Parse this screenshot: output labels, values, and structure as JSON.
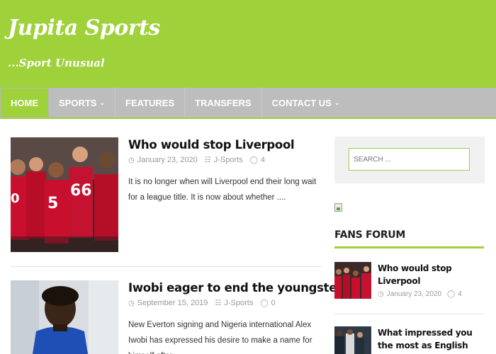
{
  "header": {
    "site_title": "Jupita Sports",
    "tagline": "...Sport Unusual",
    "bg_color": "#9ed13a"
  },
  "nav": {
    "items": [
      {
        "label": "HOME",
        "active": true,
        "dropdown": false
      },
      {
        "label": "SPORTS",
        "active": false,
        "dropdown": true
      },
      {
        "label": "FEATURES",
        "active": false,
        "dropdown": false
      },
      {
        "label": "TRANSFERS",
        "active": false,
        "dropdown": false
      },
      {
        "label": "CONTACT US",
        "active": false,
        "dropdown": true
      }
    ]
  },
  "posts": [
    {
      "title": "Who would stop Liverpool",
      "date": "January 23, 2020",
      "author": "J-Sports",
      "comments": "4",
      "excerpt": "It is no longer when will Liverpool end their long wait for a league title. It is now about whether ...."
    },
    {
      "title": "Iwobi eager to end the youngster tag",
      "date": "September 15, 2019",
      "author": "J-Sports",
      "comments": "0",
      "excerpt": "New Everton signing and Nigeria international Alex Iwobi has expressed his desire to make a name for himself after"
    }
  ],
  "sidebar": {
    "search_placeholder": "SEARCH ...",
    "widget_title": "FANS FORUM",
    "posts": [
      {
        "title": "Who would stop Liverpool",
        "date": "January 23, 2020",
        "comments": "4"
      },
      {
        "title": "What impressed you the most as English Premier League",
        "date": "",
        "comments": ""
      }
    ]
  },
  "icons": {
    "calendar": "calendar-icon",
    "author": "user-icon",
    "comment": "comment-icon",
    "caret": "chevron-down-icon"
  },
  "colors": {
    "accent": "#9ed13a",
    "nav_bg": "#bdbdbd"
  }
}
